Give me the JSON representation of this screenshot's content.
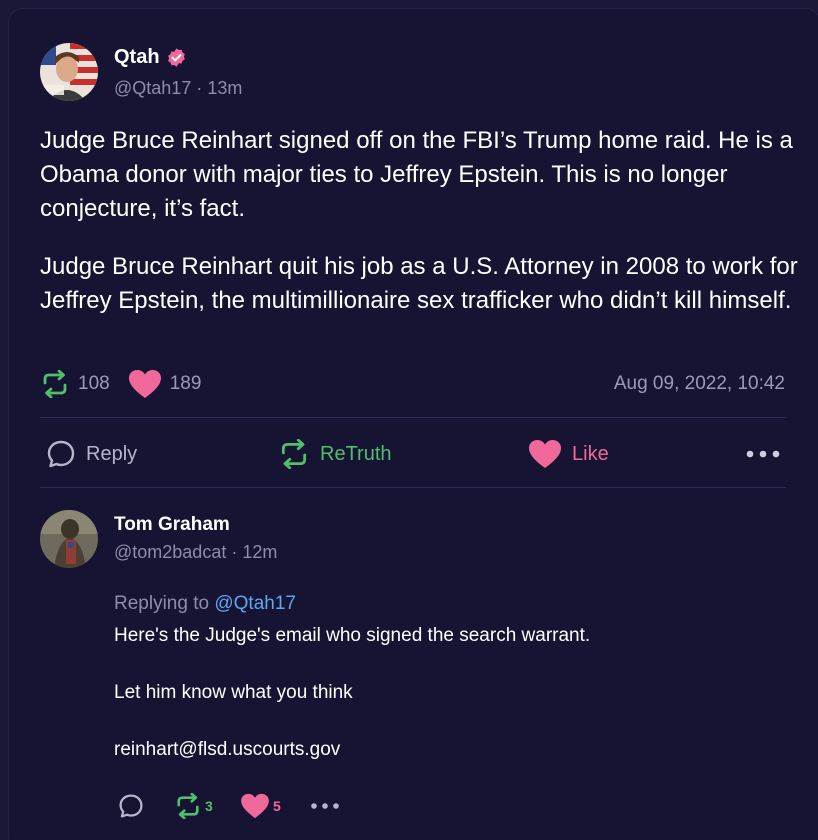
{
  "post": {
    "author_name": "Qtah",
    "handle_time": "@Qtah17 · 13m",
    "paragraphs": [
      "Judge Bruce Reinhart signed off on the FBI’s Trump home raid. He is a Obama donor with major ties to Jeffrey Epstein. This is no longer conjecture, it’s fact.",
      "Judge Bruce Reinhart quit his job as a U.S. Attorney in 2008 to work for Jeffrey Epstein, the multimillionaire sex trafficker who didn’t kill himself."
    ],
    "retruth_count": "108",
    "like_count": "189",
    "timestamp": "Aug 09, 2022, 10:42"
  },
  "actions": {
    "reply_label": "Reply",
    "retruth_label": "ReTruth",
    "like_label": "Like"
  },
  "reply": {
    "author_name": "Tom Graham",
    "handle_time": "@tom2badcat · 12m",
    "replying_prefix": "Replying to",
    "replying_mention": "@Qtah17",
    "lines": [
      "Here's the Judge's email who signed the search warrant.",
      "Let him know what you think",
      "reinhart@flsd.uscourts.gov"
    ],
    "retruth_count": "3",
    "like_count": "5"
  },
  "icons": {
    "verified": "verified-badge-icon",
    "retruth": "retruth-arrows-icon",
    "like": "heart-icon",
    "reply": "speech-bubble-icon",
    "more": "ellipsis-icon"
  },
  "colors": {
    "background": "#161432",
    "retruth_green": "#4fbf6b",
    "like_pink": "#f1699a",
    "mention_blue": "#5da8ef",
    "muted_text": "#8f8ca9"
  }
}
